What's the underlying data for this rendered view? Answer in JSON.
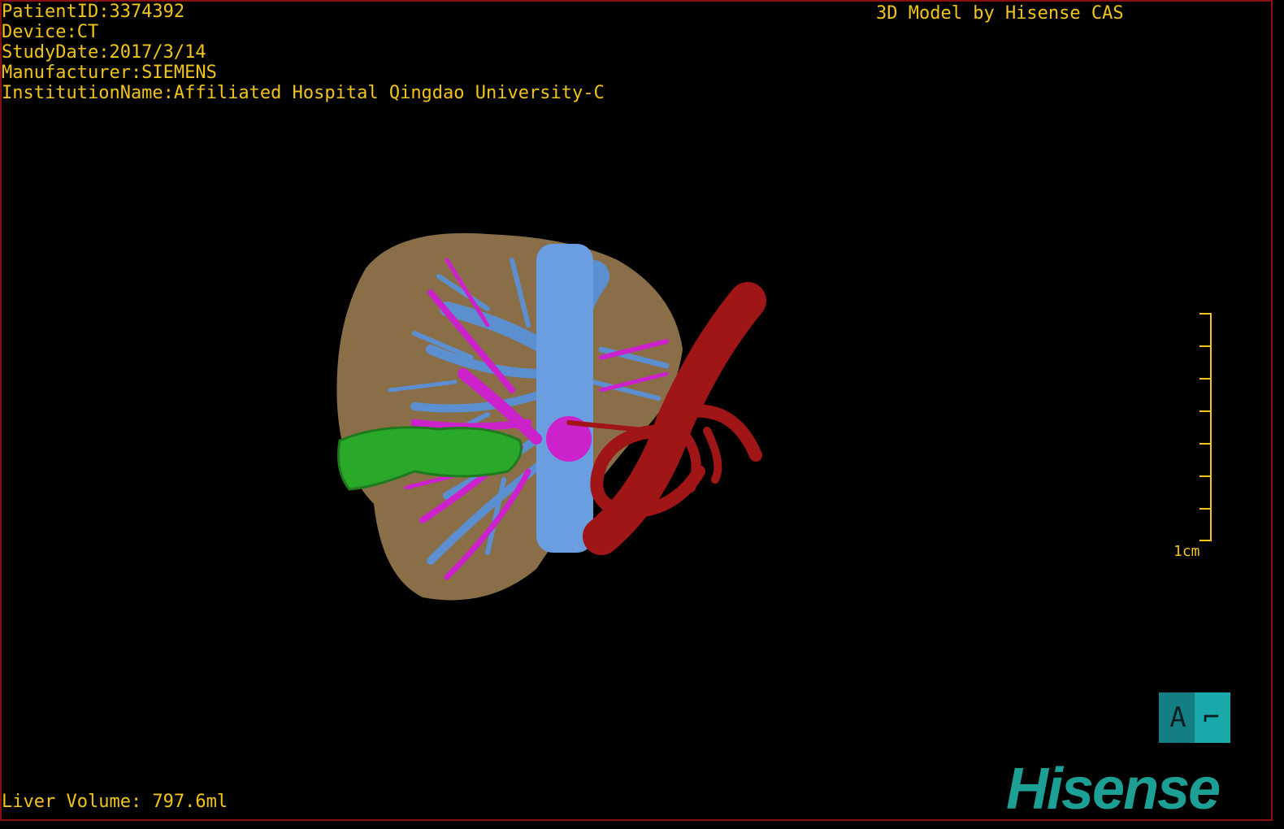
{
  "info": {
    "patient_id": "PatientID:3374392",
    "device": "Device:CT",
    "study_date": "StudyDate:2017/3/14",
    "manufacturer": "Manufacturer:SIEMENS",
    "institution": "InstitutionName:Affiliated Hospital Qingdao University-C"
  },
  "credit": "3D Model by Hisense CAS",
  "volume": "Liver Volume: 797.6ml",
  "scale": {
    "label": "1cm"
  },
  "orientation": {
    "label": "A",
    "glyph": "⌐"
  },
  "brand": {
    "logo": "Hisense",
    "color": "#1c9f94"
  },
  "colors": {
    "text": "#f0c419",
    "liver": "#8a6e48",
    "portal_vein": "#5c8fd0",
    "hepatic_vein": "#cc22cc",
    "artery": "#a01515",
    "tumor": "#2aa82a"
  }
}
